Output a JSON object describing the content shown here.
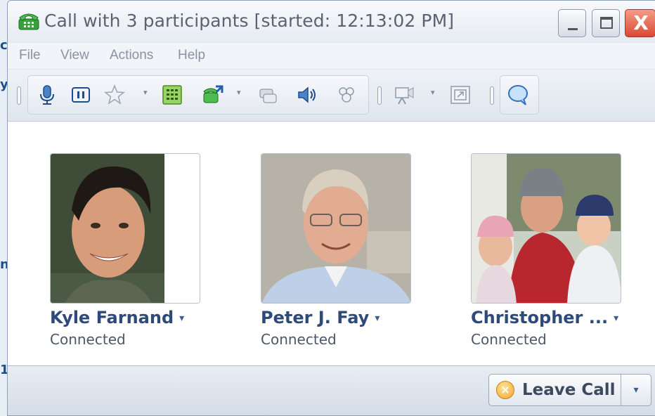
{
  "window": {
    "title": "Call with 3 participants [started: 12:13:02 PM]",
    "controls": {
      "minimize": "_",
      "maximize": "□",
      "close": "X"
    }
  },
  "menu": [
    "File",
    "View",
    "Actions",
    "Help"
  ],
  "toolbar": {
    "icons": [
      "microphone-icon",
      "hold-icon",
      "favorite-star-icon",
      "dialpad-icon",
      "transfer-call-icon",
      "merge-calls-icon",
      "speaker-volume-icon",
      "add-participants-icon",
      "video-icon",
      "fullscreen-icon",
      "chat-icon"
    ]
  },
  "participants": [
    {
      "name": "Kyle Farnand",
      "status": "Connected",
      "dropdown": "▾"
    },
    {
      "name": "Peter J. Fay",
      "status": "Connected",
      "dropdown": "▾"
    },
    {
      "name": "Christopher ...",
      "status": "Connected",
      "dropdown": "▾"
    }
  ],
  "footer": {
    "leave_call_label": "Leave Call",
    "dropdown": "▾"
  },
  "background": {
    "fragments": [
      "c",
      "y",
      "n",
      "1"
    ]
  },
  "colors": {
    "accent": "#2e4a7a",
    "close": "#d84a33",
    "title_text": "#5b6272"
  }
}
